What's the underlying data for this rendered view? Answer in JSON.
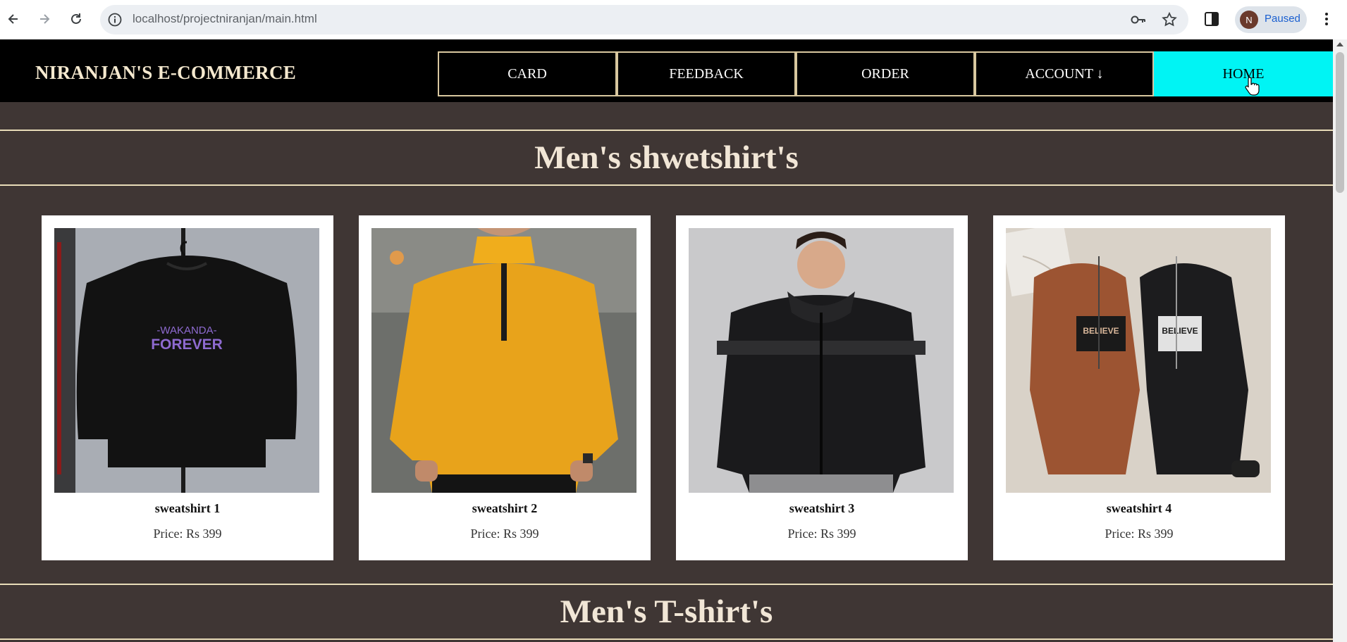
{
  "browser": {
    "url": "localhost/projectniranjan/main.html",
    "profile_initial": "N",
    "profile_status": "Paused"
  },
  "site": {
    "logo": "NIRANJAN'S E-COMMERCE",
    "nav": [
      {
        "label": "CARD"
      },
      {
        "label": "FEEDBACK"
      },
      {
        "label": "ORDER"
      },
      {
        "label": "ACCOUNT ↓"
      },
      {
        "label": "HOME",
        "active": true
      }
    ],
    "accent_color": "#00f4f4"
  },
  "sections": [
    {
      "title": "Men's shwetshirt's",
      "products": [
        {
          "name": "sweatshirt 1",
          "price": "Price: Rs 399",
          "image_logo_text": [
            "-WAKANDA-",
            "FOREVER"
          ]
        },
        {
          "name": "sweatshirt 2",
          "price": "Price: Rs 399"
        },
        {
          "name": "sweatshirt 3",
          "price": "Price: Rs 399"
        },
        {
          "name": "sweatshirt 4",
          "price": "Price: Rs 399",
          "image_logo_text": [
            "BELIEVE",
            "BELIEVE"
          ]
        }
      ]
    },
    {
      "title": "Men's T-shirt's"
    }
  ]
}
